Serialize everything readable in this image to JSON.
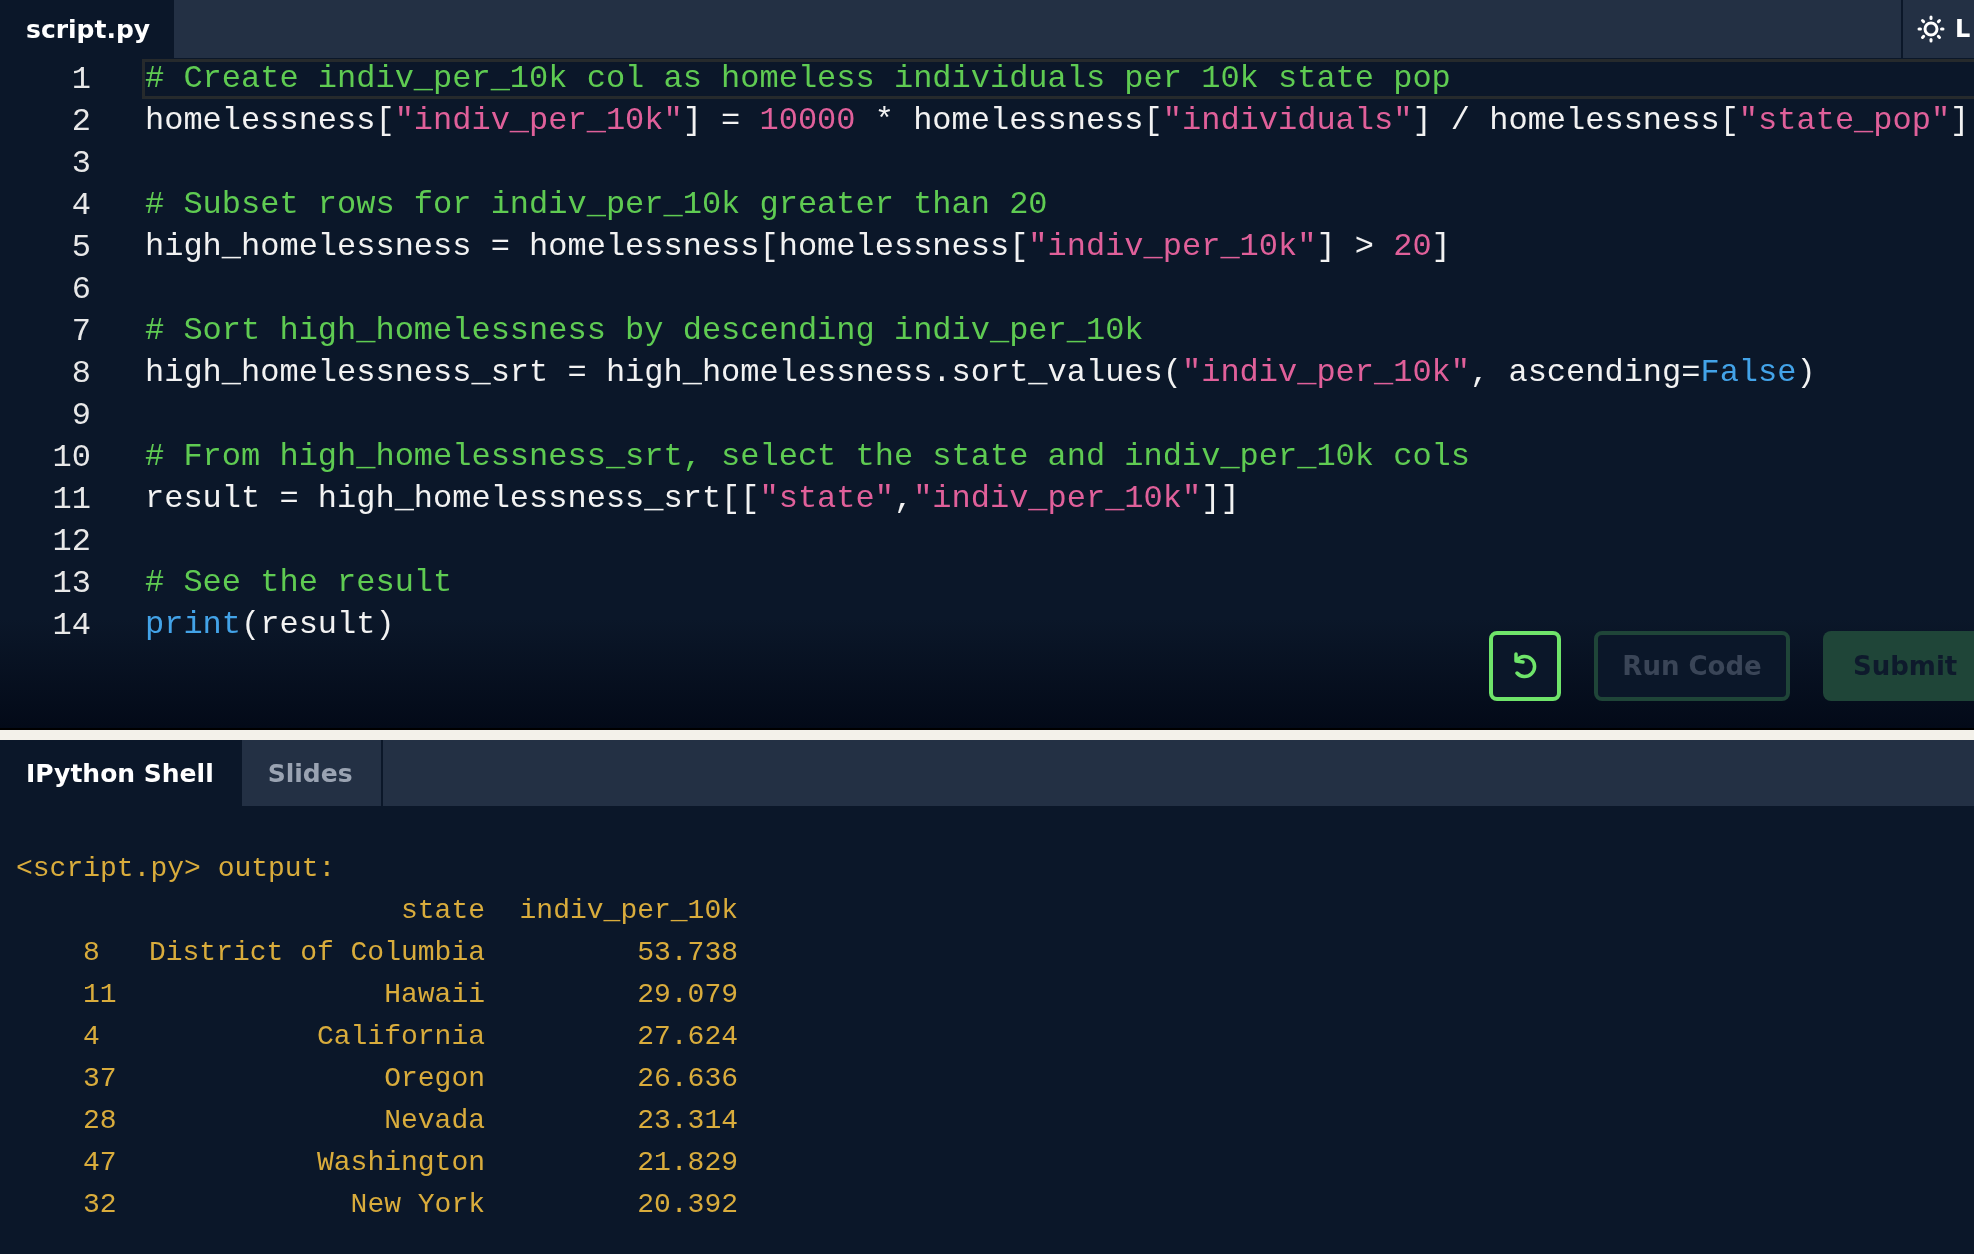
{
  "editor": {
    "file_tab": {
      "label": "script.py",
      "selected": true
    },
    "theme_toggle": {
      "label": "L"
    },
    "lines": [
      {
        "number": "1",
        "active": true,
        "tokens": [
          {
            "kind": "comment",
            "text": "# Create indiv_per_10k col as homeless individuals per 10k state pop"
          }
        ]
      },
      {
        "number": "2",
        "active": false,
        "tokens": [
          {
            "kind": "plain",
            "text": "homelessness["
          },
          {
            "kind": "string",
            "text": "\"indiv_per_10k\""
          },
          {
            "kind": "plain",
            "text": "] = "
          },
          {
            "kind": "number",
            "text": "10000"
          },
          {
            "kind": "plain",
            "text": " * homelessness["
          },
          {
            "kind": "string",
            "text": "\"individuals\""
          },
          {
            "kind": "plain",
            "text": "] / homelessness["
          },
          {
            "kind": "string",
            "text": "\"state_pop\""
          },
          {
            "kind": "plain",
            "text": "]"
          }
        ]
      },
      {
        "number": "3",
        "active": false
      },
      {
        "number": "4",
        "active": false,
        "tokens": [
          {
            "kind": "comment",
            "text": "# Subset rows for indiv_per_10k greater than 20"
          }
        ]
      },
      {
        "number": "5",
        "active": false,
        "tokens": [
          {
            "kind": "plain",
            "text": "high_homelessness = homelessness[homelessness["
          },
          {
            "kind": "string",
            "text": "\"indiv_per_10k\""
          },
          {
            "kind": "plain",
            "text": "] > "
          },
          {
            "kind": "number",
            "text": "20"
          },
          {
            "kind": "plain",
            "text": "]"
          }
        ]
      },
      {
        "number": "6",
        "active": false
      },
      {
        "number": "7",
        "active": false,
        "tokens": [
          {
            "kind": "comment",
            "text": "# Sort high_homelessness by descending indiv_per_10k"
          }
        ]
      },
      {
        "number": "8",
        "active": false,
        "tokens": [
          {
            "kind": "plain",
            "text": "high_homelessness_srt = high_homelessness.sort_values("
          },
          {
            "kind": "string",
            "text": "\"indiv_per_10k\""
          },
          {
            "kind": "plain",
            "text": ", ascending="
          },
          {
            "kind": "keyword",
            "text": "False"
          },
          {
            "kind": "plain",
            "text": ")"
          }
        ]
      },
      {
        "number": "9",
        "active": false
      },
      {
        "number": "10",
        "active": false,
        "tokens": [
          {
            "kind": "comment",
            "text": "# From high_homelessness_srt, select the state and indiv_per_10k cols"
          }
        ]
      },
      {
        "number": "11",
        "active": false,
        "tokens": [
          {
            "kind": "plain",
            "text": "result = high_homelessness_srt[["
          },
          {
            "kind": "string",
            "text": "\"state\""
          },
          {
            "kind": "plain",
            "text": ","
          },
          {
            "kind": "string",
            "text": "\"indiv_per_10k\""
          },
          {
            "kind": "plain",
            "text": "]]"
          }
        ]
      },
      {
        "number": "12",
        "active": false
      },
      {
        "number": "13",
        "active": false,
        "tokens": [
          {
            "kind": "comment",
            "text": "# See the result"
          }
        ]
      },
      {
        "number": "14",
        "active": false,
        "tokens": [
          {
            "kind": "builtin",
            "text": "print"
          },
          {
            "kind": "plain",
            "text": "(result)"
          }
        ]
      }
    ],
    "buttons": [
      {
        "kind": "reset"
      },
      {
        "kind": "run",
        "label": "Run Code"
      },
      {
        "kind": "submit",
        "label": "Submit"
      }
    ]
  },
  "shell": {
    "tabs": [
      {
        "label": "IPython Shell",
        "selected": true
      },
      {
        "label": "Slides",
        "selected": false
      }
    ],
    "output_title": "<script.py> output:",
    "columns": [
      "state",
      "indiv_per_10k"
    ],
    "rows": [
      {
        "index": "8",
        "state": "District of Columbia",
        "value": "53.738"
      },
      {
        "index": "11",
        "state": "Hawaii",
        "value": "29.079"
      },
      {
        "index": "4",
        "state": "California",
        "value": "27.624"
      },
      {
        "index": "37",
        "state": "Oregon",
        "value": "26.636"
      },
      {
        "index": "28",
        "state": "Nevada",
        "value": "23.314"
      },
      {
        "index": "47",
        "state": "Washington",
        "value": "21.829"
      },
      {
        "index": "32",
        "state": "New York",
        "value": "20.392"
      }
    ]
  }
}
